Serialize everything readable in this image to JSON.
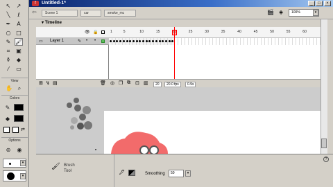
{
  "window": {
    "title": "Untitled-1*",
    "buttons": [
      "_",
      "□",
      "×"
    ]
  },
  "tools": {
    "rows": [
      [
        "arrow-icon",
        "subselect-icon"
      ],
      [
        "line-icon",
        "lasso-icon"
      ],
      [
        "pen-icon",
        "text-icon"
      ],
      [
        "oval-icon",
        "rectangle-icon"
      ],
      [
        "pencil-icon",
        "brush-icon"
      ],
      [
        "free-transform-icon",
        "fill-transform-icon"
      ],
      [
        "ink-bottle-icon",
        "paint-bucket-icon"
      ],
      [
        "eyedropper-icon",
        "eraser-icon"
      ]
    ],
    "glyphs": {
      "arrow-icon": "↖",
      "subselect-icon": "↗",
      "line-icon": "╲",
      "lasso-icon": "ℓ",
      "pen-icon": "✒",
      "text-icon": "A",
      "oval-icon": "○",
      "rectangle-icon": "□",
      "pencil-icon": "✎",
      "brush-icon": "🖌",
      "free-transform-icon": "⌗",
      "fill-transform-icon": "▣",
      "ink-bottle-icon": "⚱",
      "paint-bucket-icon": "◆",
      "eyedropper-icon": "⁄",
      "eraser-icon": "▭",
      "hand-icon": "✋",
      "zoom-icon": "🔍"
    },
    "view_label": "View",
    "colors_label": "Colors",
    "options_label": "Options"
  },
  "editbar": {
    "crumbs": [
      "Scene 1",
      "car",
      "smoke_mc"
    ],
    "zoom": "100%"
  },
  "timeline": {
    "header": "Timeline",
    "layer_name": "Layer 1",
    "ruler_numbers": [
      "1",
      "5",
      "10",
      "15",
      "20",
      "25",
      "30",
      "35",
      "40",
      "45",
      "50",
      "55",
      "60"
    ],
    "current_frame": "20",
    "frame_rate": "20.0 fps",
    "elapsed": "0.9s"
  },
  "properties": {
    "tool_name": "Brush",
    "tool_sub": "Tool",
    "smoothing_label": "Smoothing",
    "smoothing_value": "50"
  },
  "colors": {
    "stage_bg": "#ffffff",
    "work_bg": "#cccccc",
    "playhead": "#ff0000",
    "car_body": "#f26b6b"
  }
}
